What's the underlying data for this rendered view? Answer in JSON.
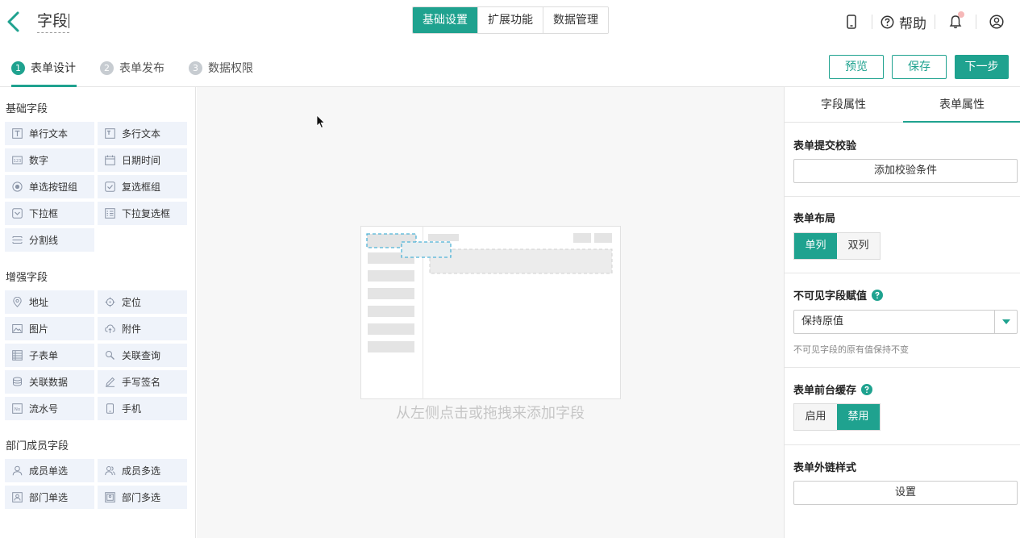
{
  "header": {
    "title": "字段",
    "tabs": [
      {
        "label": "基础设置",
        "active": true
      },
      {
        "label": "扩展功能",
        "active": false
      },
      {
        "label": "数据管理",
        "active": false
      }
    ],
    "help_label": "帮助"
  },
  "steps": [
    {
      "num": "1",
      "label": "表单设计",
      "active": true
    },
    {
      "num": "2",
      "label": "表单发布",
      "active": false
    },
    {
      "num": "3",
      "label": "数据权限",
      "active": false
    }
  ],
  "actions": {
    "preview": "预览",
    "save": "保存",
    "next": "下一步"
  },
  "sidebar": {
    "groups": [
      {
        "title": "基础字段",
        "fields": [
          {
            "label": "单行文本",
            "icon": "text-icon"
          },
          {
            "label": "多行文本",
            "icon": "textarea-icon"
          },
          {
            "label": "数字",
            "icon": "number-icon"
          },
          {
            "label": "日期时间",
            "icon": "calendar-icon"
          },
          {
            "label": "单选按钮组",
            "icon": "radio-icon"
          },
          {
            "label": "复选框组",
            "icon": "checkbox-icon"
          },
          {
            "label": "下拉框",
            "icon": "dropdown-icon"
          },
          {
            "label": "下拉复选框",
            "icon": "multi-dropdown-icon"
          },
          {
            "label": "分割线",
            "icon": "divider-icon"
          }
        ]
      },
      {
        "title": "增强字段",
        "fields": [
          {
            "label": "地址",
            "icon": "location-pin-icon"
          },
          {
            "label": "定位",
            "icon": "crosshair-icon"
          },
          {
            "label": "图片",
            "icon": "image-icon"
          },
          {
            "label": "附件",
            "icon": "cloud-upload-icon"
          },
          {
            "label": "子表单",
            "icon": "subform-icon"
          },
          {
            "label": "关联查询",
            "icon": "link-query-icon"
          },
          {
            "label": "关联数据",
            "icon": "link-data-icon"
          },
          {
            "label": "手写签名",
            "icon": "pen-icon"
          },
          {
            "label": "流水号",
            "icon": "serial-number-icon"
          },
          {
            "label": "手机",
            "icon": "phone-icon"
          }
        ]
      },
      {
        "title": "部门成员字段",
        "fields": [
          {
            "label": "成员单选",
            "icon": "user-icon"
          },
          {
            "label": "成员多选",
            "icon": "users-icon"
          },
          {
            "label": "部门单选",
            "icon": "department-icon"
          },
          {
            "label": "部门多选",
            "icon": "departments-icon"
          }
        ]
      }
    ]
  },
  "canvas": {
    "empty_hint": "从左侧点击或拖拽来添加字段"
  },
  "panel": {
    "tabs": [
      {
        "label": "字段属性",
        "active": false
      },
      {
        "label": "表单属性",
        "active": true
      }
    ],
    "submit_validation": {
      "title": "表单提交校验",
      "button": "添加校验条件"
    },
    "layout": {
      "title": "表单布局",
      "options": [
        "单列",
        "双列"
      ],
      "selected": "单列"
    },
    "invisible_field": {
      "title": "不可见字段赋值",
      "value": "保持原值",
      "hint": "不可见字段的原有值保持不变"
    },
    "cache": {
      "title": "表单前台缓存",
      "options": [
        "启用",
        "禁用"
      ],
      "selected": "禁用"
    },
    "external_link": {
      "title": "表单外链样式",
      "button": "设置"
    }
  },
  "colors": {
    "accent": "#1fa28f",
    "field_bg": "#eff3fa",
    "canvas_bg": "#f7f7f7"
  }
}
